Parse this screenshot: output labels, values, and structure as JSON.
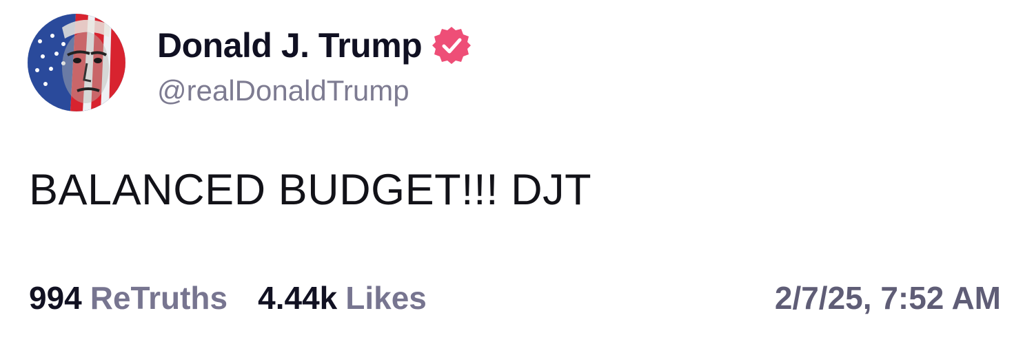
{
  "author": {
    "display_name": "Donald J. Trump",
    "handle": "@realDonaldTrump",
    "verified": true,
    "avatar_icon": "flag-portrait-avatar",
    "verified_icon": "verified-badge-icon",
    "badge_color": "#ee4e77"
  },
  "post": {
    "text": "BALANCED BUDGET!!! DJT"
  },
  "stats": {
    "retruths_count": "994",
    "retruths_label": "ReTruths",
    "likes_count": "4.44k",
    "likes_label": "Likes"
  },
  "timestamp": "2/7/25, 7:52 AM"
}
